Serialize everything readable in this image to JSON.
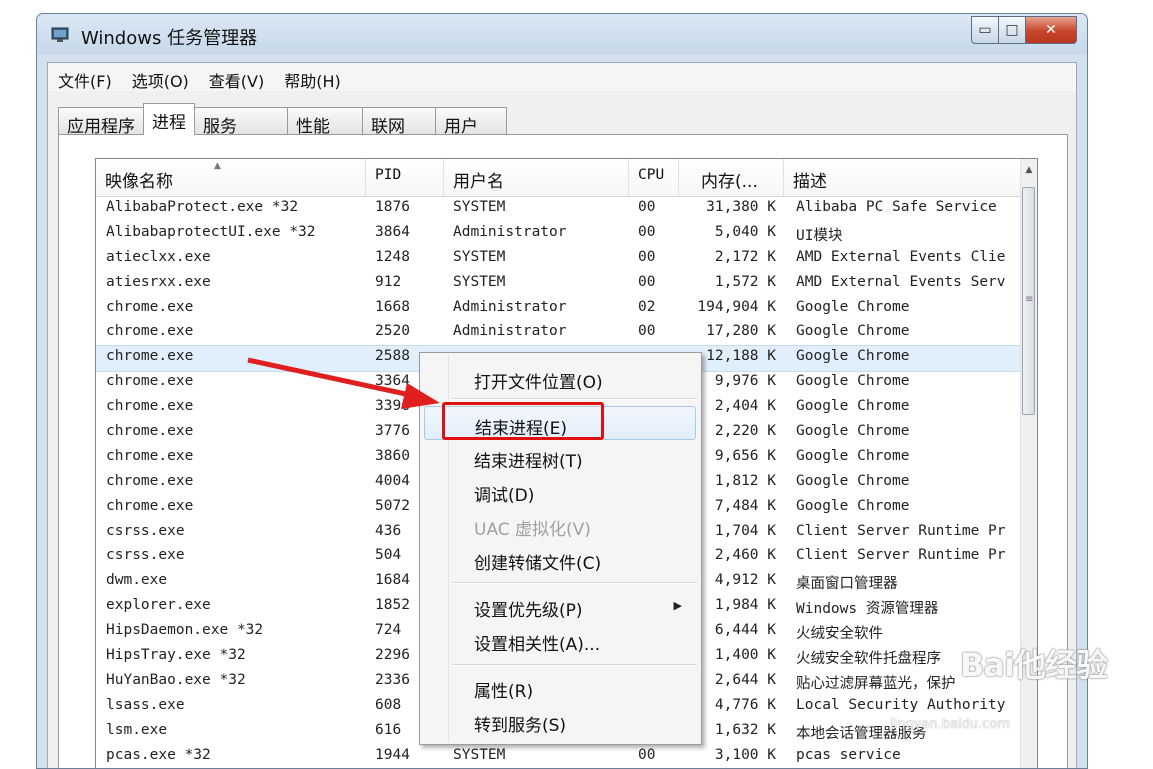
{
  "window": {
    "title": "Windows 任务管理器",
    "icon": "monitor-icon",
    "buttons": {
      "minimize": "▭",
      "maximize": "□",
      "close": "✕"
    }
  },
  "menubar": [
    "文件(F)",
    "选项(O)",
    "查看(V)",
    "帮助(H)"
  ],
  "tabs": [
    {
      "label": "应用程序",
      "active": false
    },
    {
      "label": "进程",
      "active": true
    },
    {
      "label": "服务",
      "active": false
    },
    {
      "label": "性能",
      "active": false
    },
    {
      "label": "联网",
      "active": false
    },
    {
      "label": "用户",
      "active": false
    }
  ],
  "table": {
    "headers": [
      "映像名称",
      "PID",
      "用户名",
      "CPU",
      "内存(...",
      "描述"
    ],
    "sorted_column": "映像名称",
    "rows": [
      [
        "AlibabaProtect.exe *32",
        "1876",
        "SYSTEM",
        "00",
        "31,380 K",
        "Alibaba PC Safe Service"
      ],
      [
        "AlibabaprotectUI.exe *32",
        "3864",
        "Administrator",
        "00",
        "5,040 K",
        "UI模块"
      ],
      [
        "atieclxx.exe",
        "1248",
        "SYSTEM",
        "00",
        "2,172 K",
        "AMD External Events Clie"
      ],
      [
        "atiesrxx.exe",
        "912",
        "SYSTEM",
        "00",
        "1,572 K",
        "AMD External Events Serv"
      ],
      [
        "chrome.exe",
        "1668",
        "Administrator",
        "02",
        "194,904 K",
        "Google Chrome"
      ],
      [
        "chrome.exe",
        "2520",
        "Administrator",
        "00",
        "17,280 K",
        "Google Chrome"
      ],
      [
        "chrome.exe",
        "2588",
        "",
        "",
        "12,188 K",
        "Google Chrome"
      ],
      [
        "chrome.exe",
        "3364",
        "",
        "",
        "9,976 K",
        "Google Chrome"
      ],
      [
        "chrome.exe",
        "3396",
        "",
        "",
        "2,404 K",
        "Google Chrome"
      ],
      [
        "chrome.exe",
        "3776",
        "",
        "",
        "2,220 K",
        "Google Chrome"
      ],
      [
        "chrome.exe",
        "3860",
        "",
        "",
        "9,656 K",
        "Google Chrome"
      ],
      [
        "chrome.exe",
        "4004",
        "",
        "",
        "1,812 K",
        "Google Chrome"
      ],
      [
        "chrome.exe",
        "5072",
        "",
        "",
        "7,484 K",
        "Google Chrome"
      ],
      [
        "csrss.exe",
        "436",
        "",
        "",
        "1,704 K",
        "Client Server Runtime Pr"
      ],
      [
        "csrss.exe",
        "504",
        "",
        "",
        "2,460 K",
        "Client Server Runtime Pr"
      ],
      [
        "dwm.exe",
        "1684",
        "",
        "",
        "4,912 K",
        "桌面窗口管理器"
      ],
      [
        "explorer.exe",
        "1852",
        "",
        "",
        "1,984 K",
        "Windows 资源管理器"
      ],
      [
        "HipsDaemon.exe *32",
        "724",
        "",
        "",
        "6,444 K",
        "火绒安全软件"
      ],
      [
        "HipsTray.exe *32",
        "2296",
        "",
        "",
        "1,400 K",
        "火绒安全软件托盘程序"
      ],
      [
        "HuYanBao.exe *32",
        "2336",
        "",
        "",
        "2,644 K",
        "贴心过滤屏幕蓝光，保护"
      ],
      [
        "lsass.exe",
        "608",
        "",
        "",
        "4,776 K",
        "Local Security Authority"
      ],
      [
        "lsm.exe",
        "616",
        "",
        "",
        "1,632 K",
        "本地会话管理器服务"
      ],
      [
        "pcas.exe *32",
        "1944",
        "SYSTEM",
        "00",
        "3,100 K",
        "pcas service"
      ]
    ],
    "selected_row": 6
  },
  "context_menu": {
    "items": [
      {
        "label": "打开文件位置(O)",
        "enabled": true
      },
      {
        "label": "结束进程(E)",
        "enabled": true,
        "highlighted": true
      },
      {
        "label": "结束进程树(T)",
        "enabled": true
      },
      {
        "label": "调试(D)",
        "enabled": true
      },
      {
        "label": "UAC 虚拟化(V)",
        "enabled": false
      },
      {
        "label": "创建转储文件(C)",
        "enabled": true
      },
      {
        "label": "设置优先级(P)",
        "enabled": true,
        "submenu": true
      },
      {
        "label": "设置相关性(A)...",
        "enabled": true
      },
      {
        "label": "属性(R)",
        "enabled": true
      },
      {
        "label": "转到服务(S)",
        "enabled": true
      }
    ],
    "submenu_icon": "▶"
  },
  "annotation": {
    "arrow_color": "#e02020",
    "box_color": "#e01010"
  },
  "watermark": {
    "text": "Bai他经验",
    "sub": "jingyan.baidu.com"
  }
}
